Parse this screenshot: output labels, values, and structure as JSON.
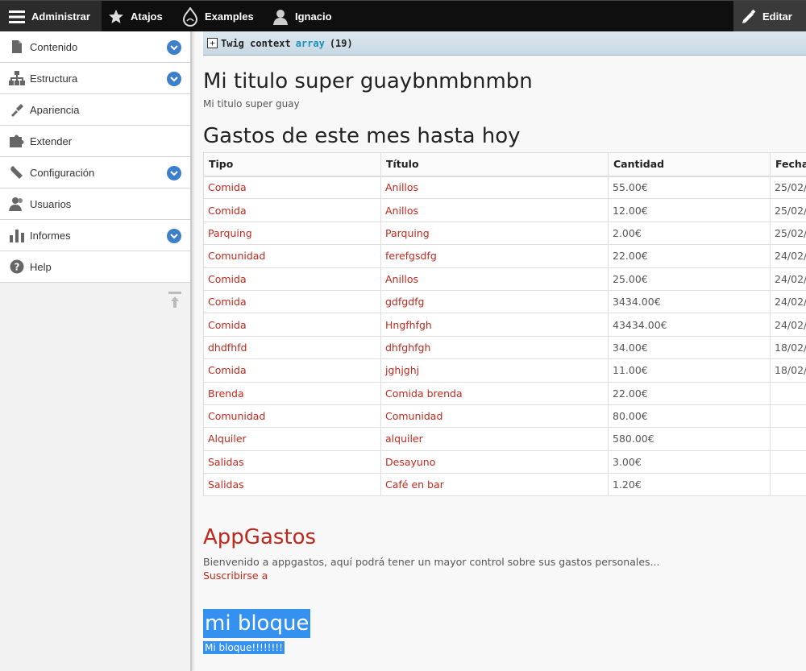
{
  "toolbar": {
    "admin_label": "Administrar",
    "atajos_label": "Atajos",
    "examples_label": "Examples",
    "user_label": "Ignacio",
    "edit_label": "Editar"
  },
  "sidebar": {
    "items": [
      {
        "label": "Contenido",
        "icon": "file-icon",
        "expandable": true
      },
      {
        "label": "Estructura",
        "icon": "sitemap-icon",
        "expandable": true
      },
      {
        "label": "Apariencia",
        "icon": "brush-icon",
        "expandable": false
      },
      {
        "label": "Extender",
        "icon": "puzzle-icon",
        "expandable": false
      },
      {
        "label": "Configuración",
        "icon": "wrench-icon",
        "expandable": true
      },
      {
        "label": "Usuarios",
        "icon": "users-icon",
        "expandable": false
      },
      {
        "label": "Informes",
        "icon": "bar-chart-icon",
        "expandable": true
      },
      {
        "label": "Help",
        "icon": "help-icon",
        "expandable": false
      }
    ]
  },
  "twig": {
    "label": "Twig context",
    "type": "array",
    "count": "(19)"
  },
  "page": {
    "title": "Mi titulo super guaybnmbnmbn",
    "subtitle": "Mi titulo super guay",
    "table_heading": "Gastos de este mes hasta hoy"
  },
  "table": {
    "headers": [
      "Tipo",
      "Título",
      "Cantidad",
      "Fecha"
    ],
    "rows": [
      [
        "Comida",
        "Anillos",
        "55.00€",
        "25/02/"
      ],
      [
        "Comida",
        "Anillos",
        "12.00€",
        "25/02/"
      ],
      [
        "Parquing",
        "Parquing",
        "2.00€",
        "25/02/"
      ],
      [
        "Comunidad",
        "ferefgsdfg",
        "22.00€",
        "24/02/"
      ],
      [
        "Comida",
        "Anillos",
        "25.00€",
        "24/02/"
      ],
      [
        "Comida",
        "gdfgdfg",
        "3434.00€",
        "24/02/"
      ],
      [
        "Comida",
        "Hngfhfgh",
        "43434.00€",
        "24/02/"
      ],
      [
        "dhdfhfd",
        "dhfghfgh",
        "34.00€",
        "18/02/"
      ],
      [
        "Comida",
        "jghjghj",
        "11.00€",
        "18/02/"
      ],
      [
        "Brenda",
        "Comida brenda",
        "22.00€",
        ""
      ],
      [
        "Comunidad",
        "Comunidad",
        "80.00€",
        ""
      ],
      [
        "Alquiler",
        "alquiler",
        "580.00€",
        ""
      ],
      [
        "Salidas",
        "Desayuno",
        "3.00€",
        ""
      ],
      [
        "Salidas",
        "Café en bar",
        "1.20€",
        ""
      ]
    ]
  },
  "app": {
    "title": "AppGastos",
    "text": "Bienvenido a appgastos, aquí podrá tener un mayor control sobre sus gastos personales...",
    "link": "Suscribirse a"
  },
  "block": {
    "title": "mi bloque",
    "body": "Mi bloque!!!!!!!!"
  },
  "colors": {
    "link": "#c0281c",
    "accent": "#3d7fc8",
    "highlight": "#3591f0"
  }
}
